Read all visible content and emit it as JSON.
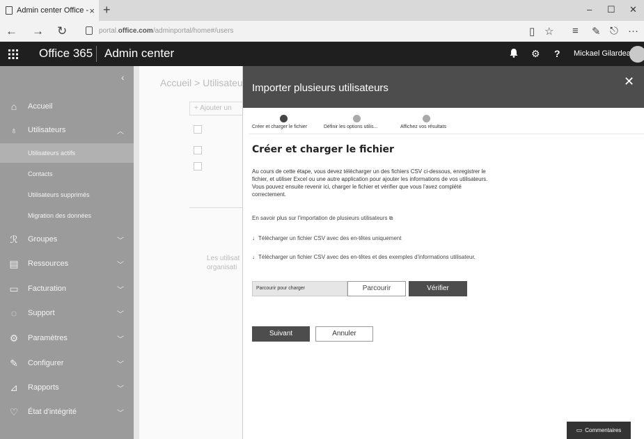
{
  "browser": {
    "tab_title": "Admin center Office - U",
    "tab_close": "×",
    "new_tab": "+",
    "url_prefix": "portal.",
    "url_domain": "office.com",
    "url_path": "/adminportal/home#/users",
    "icons": {
      "back": "←",
      "forward": "→",
      "refresh": "↻",
      "reading": "▯",
      "favorite": "☆",
      "hub": "≡",
      "note": "✎",
      "share": "⎋",
      "more": "···"
    }
  },
  "header": {
    "brand": "Office 365",
    "title": "Admin center",
    "user_name": "Mickael Gilardeau",
    "icons": {
      "waffle": "⋮⋮⋮",
      "bell": "🔔",
      "gear": "⚙",
      "help": "?"
    }
  },
  "sidebar": {
    "collapse_glyph": "‹",
    "items": [
      {
        "icon": "⌂",
        "label": "Accueil",
        "chev": ""
      },
      {
        "icon": "♁",
        "label": "Utilisateurs",
        "chev": "︿"
      },
      {
        "icon": "ℛ",
        "label": "Groupes",
        "chev": "﹀"
      },
      {
        "icon": "▤",
        "label": "Ressources",
        "chev": "﹀"
      },
      {
        "icon": "▭",
        "label": "Facturation",
        "chev": "﹀"
      },
      {
        "icon": "◌",
        "label": "Support",
        "chev": "﹀"
      },
      {
        "icon": "⚙",
        "label": "Paramètres",
        "chev": "﹀"
      },
      {
        "icon": "✎",
        "label": "Configurer",
        "chev": "﹀"
      },
      {
        "icon": "⊿",
        "label": "Rapports",
        "chev": "﹀"
      },
      {
        "icon": "♡",
        "label": "État d'intégrité",
        "chev": "﹀"
      }
    ],
    "subitems": [
      {
        "label": "Utilisateurs actifs"
      },
      {
        "label": "Contacts"
      },
      {
        "label": "Utilisateurs supprimés"
      },
      {
        "label": "Migration des données"
      }
    ]
  },
  "background_page": {
    "breadcrumb": "Accueil > Utilisateu",
    "add_button": "+ Ajouter un",
    "text_line1": "Les utilisat",
    "text_line2": "organisati"
  },
  "panel": {
    "title": "Importer plusieurs utilisateurs",
    "close_glyph": "✕",
    "steps": [
      {
        "label": "Créer et charger le fichier",
        "active": true
      },
      {
        "label": "Définir les options utilis...",
        "active": false
      },
      {
        "label": "Affichez vos résultats",
        "active": false
      }
    ],
    "section_title": "Créer et charger le fichier",
    "description": "Au cours de cette étape, vous devez télécharger un des fichiers CSV ci-dessous, enregistrer le fichier, et utiliser Excel ou une autre application pour ajouter les informations de vos utilisateurs. Vous pouvez ensuite revenir ici, charger le fichier et vérifier que vous l'avez complété correctement.",
    "learn_more": "En savoir plus sur l'importation de plusieurs utilisateurs",
    "external_glyph": "⧉",
    "download_glyph": "↓",
    "download1": "Télécharger un fichier CSV avec des en-têtes uniquement",
    "download2": "Télécharger un fichier CSV avec des en-têtes et des exemples d'informations utilisateur.",
    "file_placeholder": "Parcourir pour charger",
    "browse_label": "Parcourir",
    "verify_label": "Vérifier",
    "next_label": "Suivant",
    "cancel_label": "Annuler",
    "feedback_icon": "▭",
    "feedback_label": "Commentaires"
  }
}
